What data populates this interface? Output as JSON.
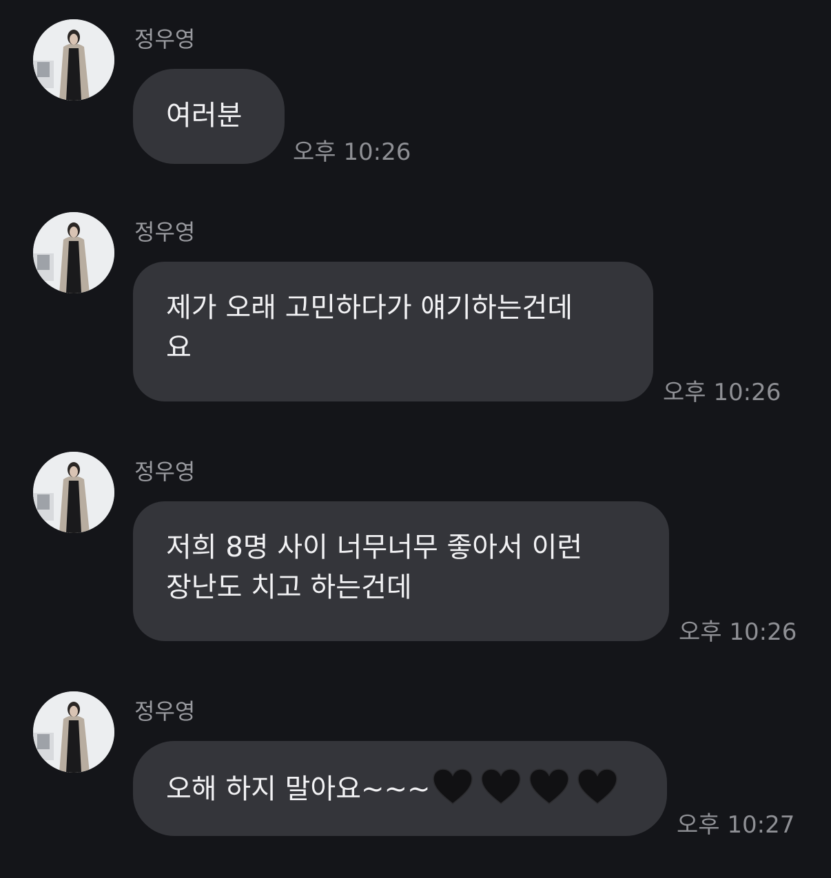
{
  "messages": [
    {
      "sender": "정우영",
      "lines": [
        "여러분"
      ],
      "time": "오후 10:26"
    },
    {
      "sender": "정우영",
      "lines": [
        "제가 오래 고민하다가 얘기하는건데",
        "요"
      ],
      "time": "오후 10:26"
    },
    {
      "sender": "정우영",
      "lines": [
        "저희 8명 사이 너무너무 좋아서 이런",
        "장난도 치고 하는건데"
      ],
      "time": "오후 10:26"
    },
    {
      "sender": "정우영",
      "lines": [
        "오해 하지 말아요~~~"
      ],
      "emoji": [
        "black-heart-icon",
        "black-heart-icon",
        "black-heart-icon",
        "black-heart-icon"
      ],
      "time": "오후 10:27"
    }
  ],
  "colors": {
    "background": "#141519",
    "bubble": "#34353a",
    "text": "#f2f2f4",
    "meta": "#9a9ba0"
  }
}
